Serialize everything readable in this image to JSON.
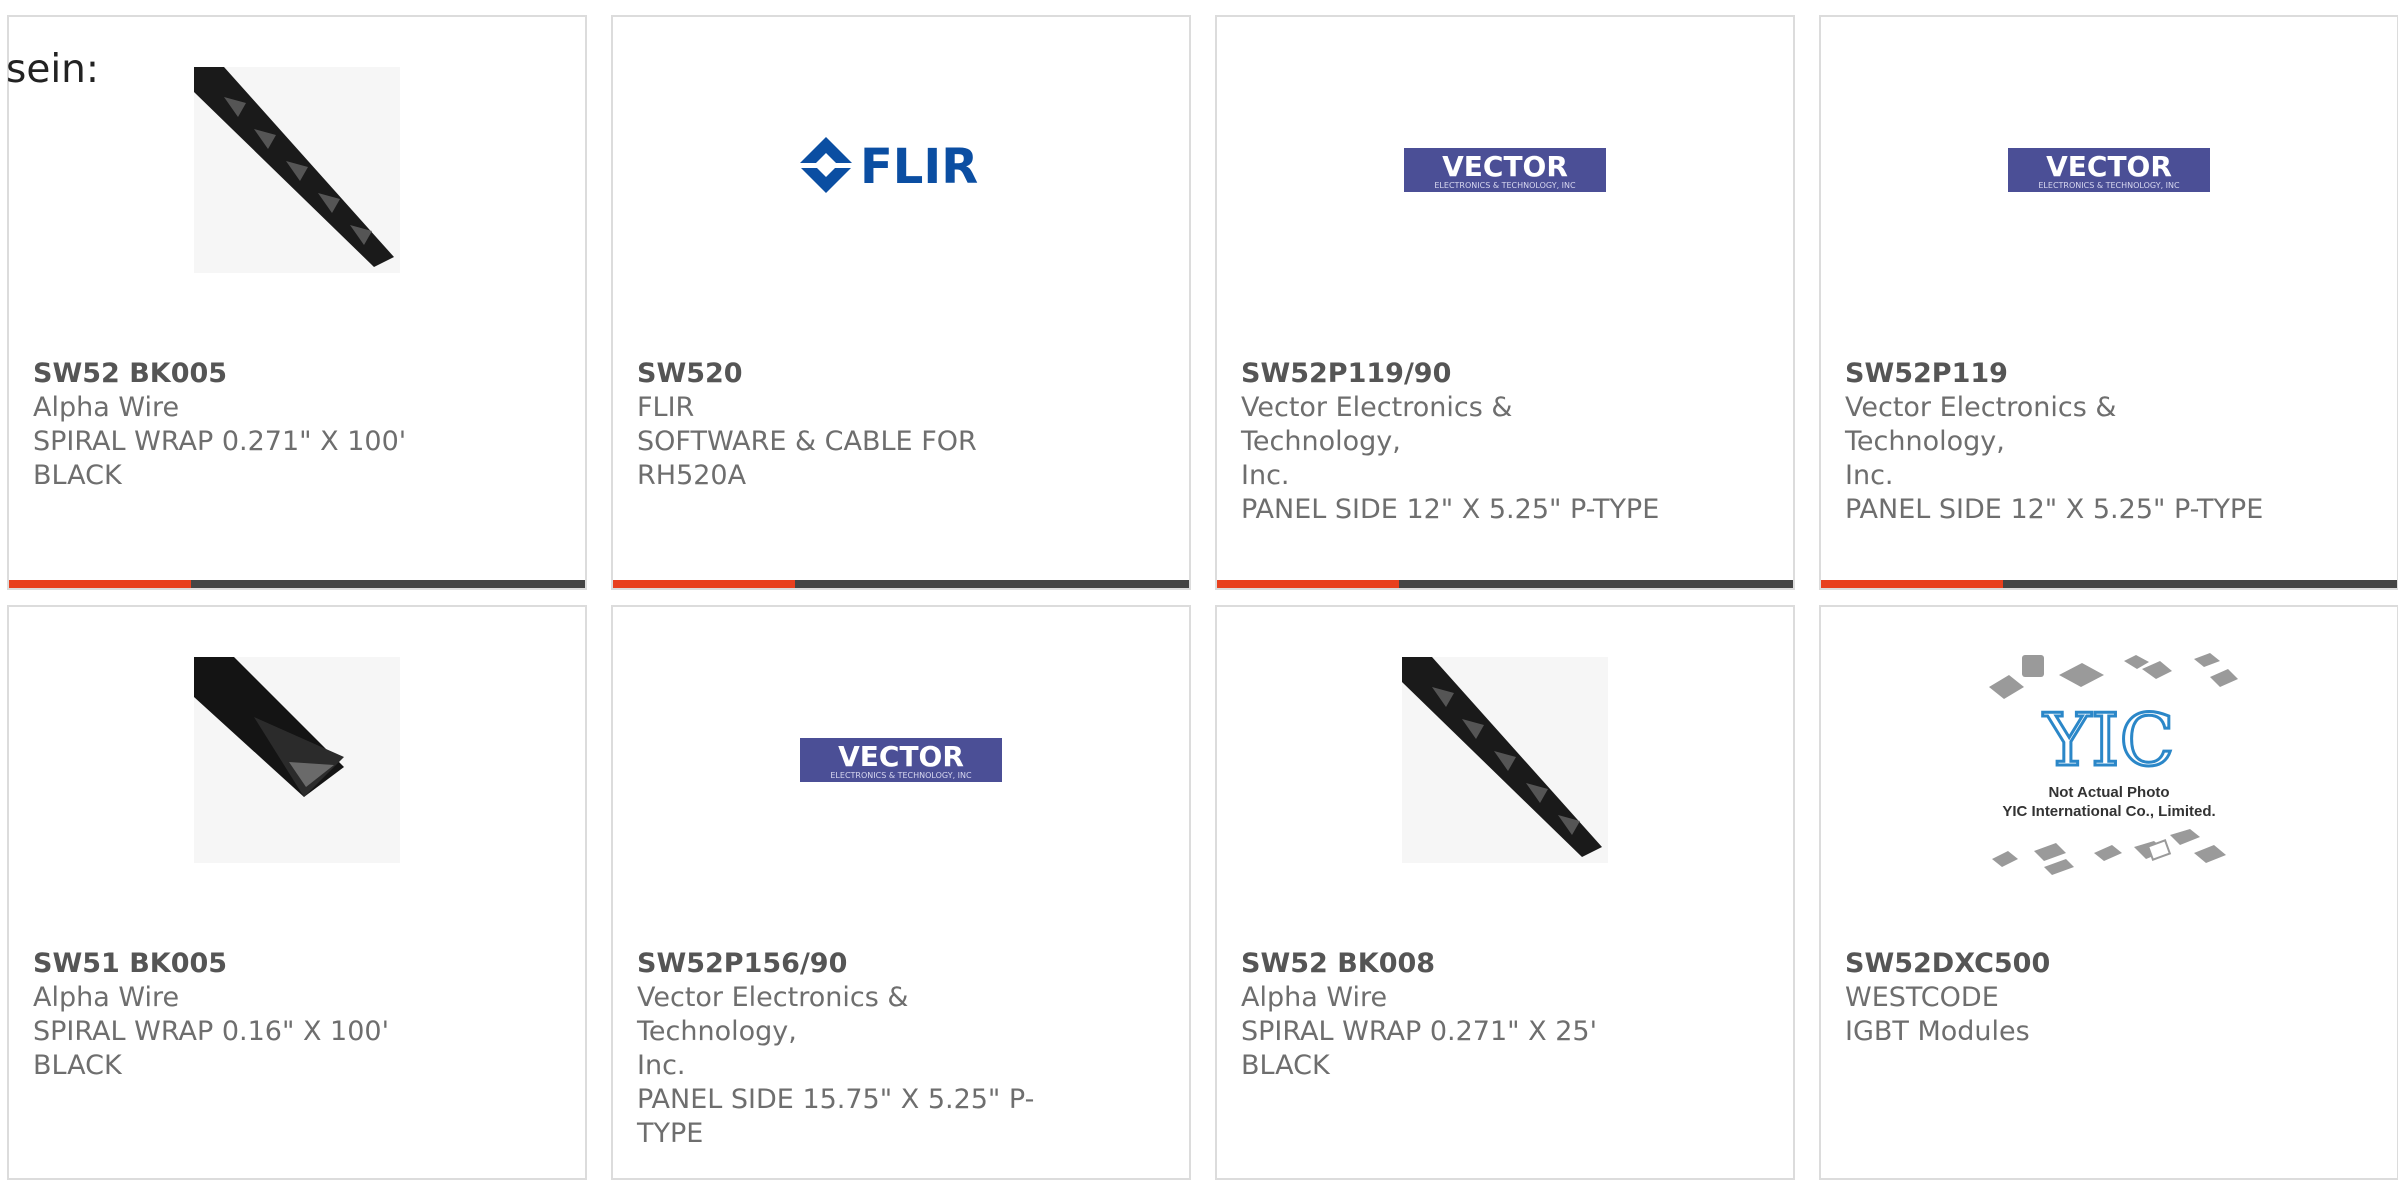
{
  "header": {
    "text": "sein:"
  },
  "colors": {
    "accent": "#e8401e",
    "bar_dark": "#444444",
    "vector_blue": "#4b4f96",
    "flir_blue": "#0b4ea2"
  },
  "products": [
    {
      "part_number": "SW52 BK005",
      "manufacturer": "Alpha Wire",
      "description": "SPIRAL WRAP 0.271\" X 100'",
      "description_2": "BLACK",
      "image": "spiral-wrap-icon"
    },
    {
      "part_number": "SW520",
      "manufacturer": "FLIR",
      "description": "SOFTWARE & CABLE FOR",
      "description_2": "RH520A",
      "image": "flir-logo",
      "logo_text": "FLIR"
    },
    {
      "part_number": "SW52P119/90",
      "manufacturer": "Vector Electronics & Technology,",
      "description": "Inc.",
      "description_2": "PANEL SIDE 12\" X 5.25\" P-TYPE",
      "image": "vector-logo",
      "logo_text": "VECTOR",
      "logo_subtext": "ELECTRONICS & TECHNOLOGY, INC"
    },
    {
      "part_number": "SW52P119",
      "manufacturer": "Vector Electronics & Technology,",
      "description": "Inc.",
      "description_2": "PANEL SIDE 12\" X 5.25\" P-TYPE",
      "image": "vector-logo",
      "logo_text": "VECTOR",
      "logo_subtext": "ELECTRONICS & TECHNOLOGY, INC"
    },
    {
      "part_number": "SW51 BK005",
      "manufacturer": "Alpha Wire",
      "description": "SPIRAL WRAP 0.16\" X 100'",
      "description_2": "BLACK",
      "image": "spiral-wrap-icon"
    },
    {
      "part_number": "SW52P156/90",
      "manufacturer": "Vector Electronics & Technology,",
      "description": "Inc.",
      "description_2": "PANEL SIDE 15.75\" X 5.25\" P-",
      "description_3": "TYPE",
      "image": "vector-logo",
      "logo_text": "VECTOR",
      "logo_subtext": "ELECTRONICS & TECHNOLOGY, INC"
    },
    {
      "part_number": "SW52 BK008",
      "manufacturer": "Alpha Wire",
      "description": "SPIRAL WRAP 0.271\" X 25'",
      "description_2": "BLACK",
      "image": "spiral-wrap-icon"
    },
    {
      "part_number": "SW52DXC500",
      "manufacturer": "WESTCODE",
      "description": "IGBT Modules",
      "image": "yic-placeholder",
      "logo_text": "YIC",
      "placeholder_line_1": "Not Actual Photo",
      "placeholder_line_2": "YIC International Co., Limited."
    }
  ]
}
